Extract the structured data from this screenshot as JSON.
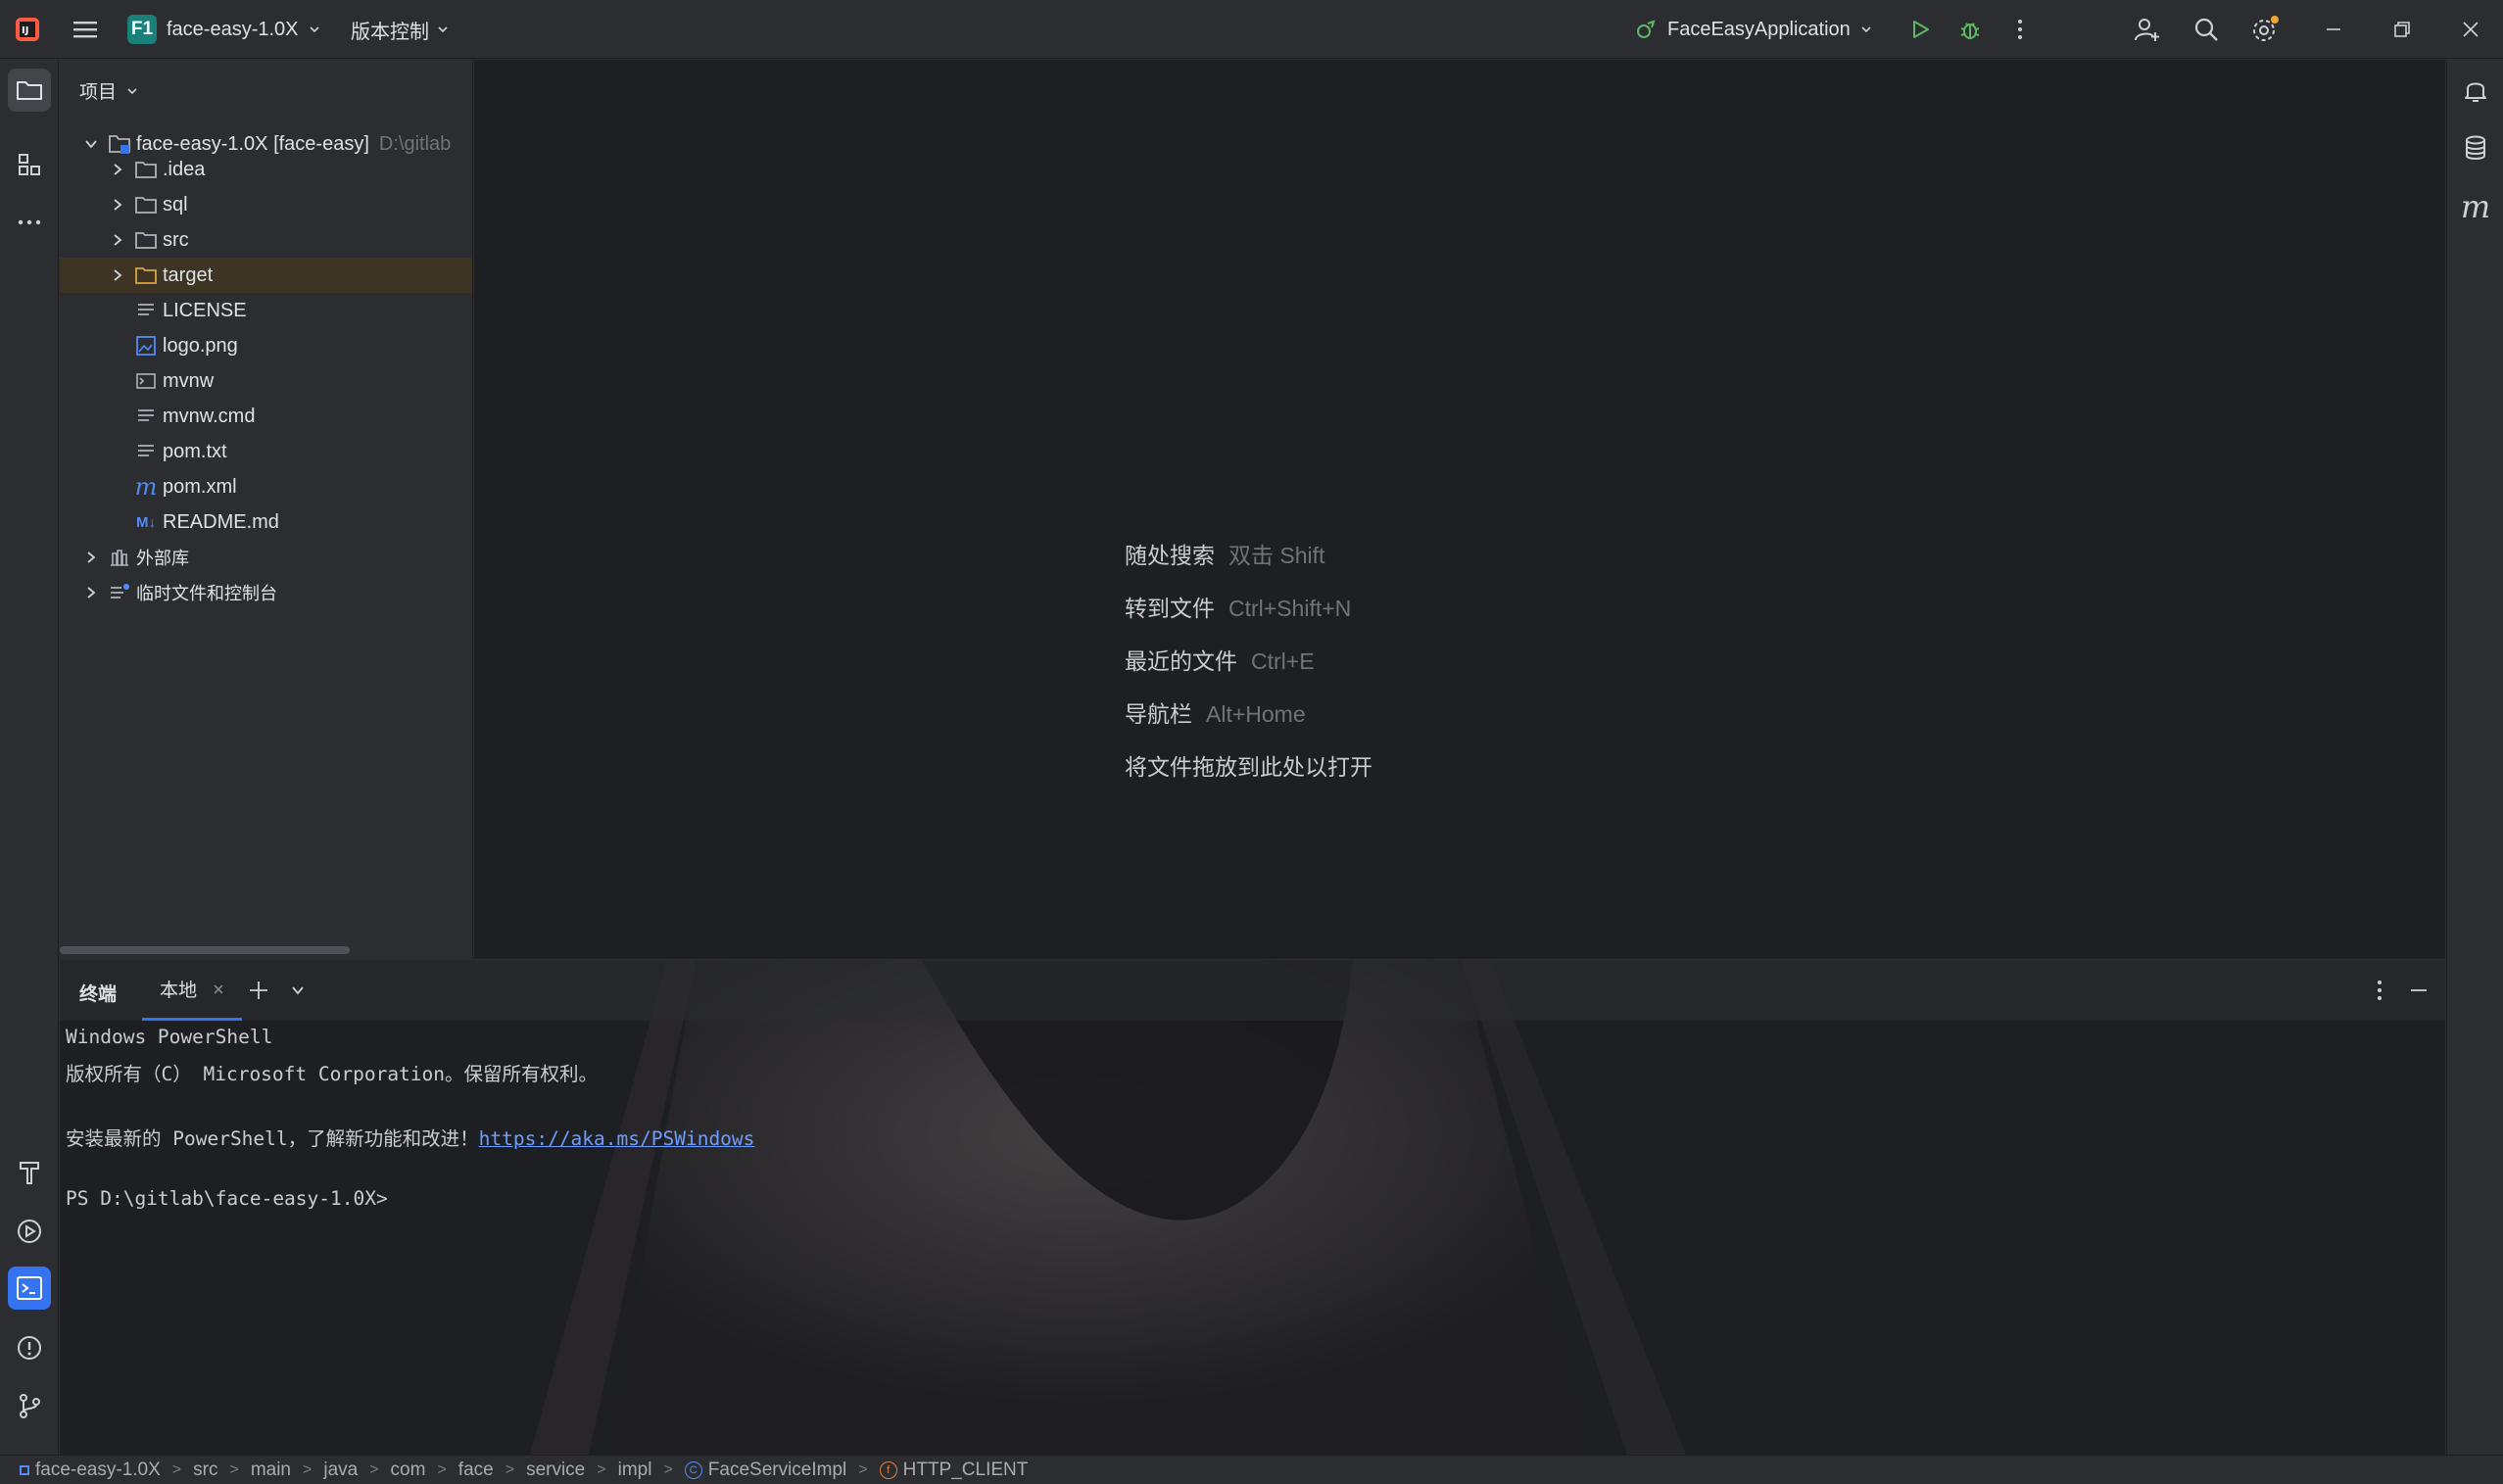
{
  "titlebar": {
    "project_badge": "F1",
    "project_name": "face-easy-1.0X",
    "vcs_label": "版本控制",
    "run_config": "FaceEasyApplication"
  },
  "project_panel": {
    "header": "项目",
    "root_name": "face-easy-1.0X [face-easy]",
    "root_path": "D:\\gitlab",
    "items": [
      {
        "label": "idea",
        "display": ".idea"
      },
      {
        "label": "sql",
        "display": "sql"
      },
      {
        "label": "src",
        "display": "src"
      },
      {
        "label": "target",
        "display": "target"
      },
      {
        "label": "LICENSE",
        "display": "LICENSE"
      },
      {
        "label": "logo.png",
        "display": "logo.png"
      },
      {
        "label": "mvnw",
        "display": "mvnw"
      },
      {
        "label": "mvnw.cmd",
        "display": "mvnw.cmd"
      },
      {
        "label": "pom.txt",
        "display": "pom.txt"
      },
      {
        "label": "pom.xml",
        "display": "pom.xml"
      },
      {
        "label": "README.md",
        "display": "README.md"
      }
    ],
    "external_libs": "外部库",
    "scratches": "临时文件和控制台"
  },
  "editor_hints": [
    {
      "label": "随处搜索",
      "key": "双击 Shift"
    },
    {
      "label": "转到文件",
      "key": "Ctrl+Shift+N"
    },
    {
      "label": "最近的文件",
      "key": "Ctrl+E"
    },
    {
      "label": "导航栏",
      "key": "Alt+Home"
    },
    {
      "label": "将文件拖放到此处以打开",
      "key": ""
    }
  ],
  "terminal": {
    "title": "终端",
    "tab_label": "本地",
    "line1": "Windows PowerShell",
    "line2": "版权所有（C） Microsoft Corporation。保留所有权利。",
    "line3_prefix": "安装最新的 PowerShell，了解新功能和改进！",
    "line3_link": "https://aka.ms/PSWindows",
    "prompt": "PS D:\\gitlab\\face-easy-1.0X>"
  },
  "statusbar": {
    "crumbs": [
      "face-easy-1.0X",
      "src",
      "main",
      "java",
      "com",
      "face",
      "service",
      "impl",
      "FaceServiceImpl",
      "HTTP_CLIENT"
    ]
  },
  "colors": {
    "accent": "#3574f0",
    "folder": "#aeb3bb",
    "excluded_folder": "#d9a343",
    "run_green": "#5fb865"
  }
}
